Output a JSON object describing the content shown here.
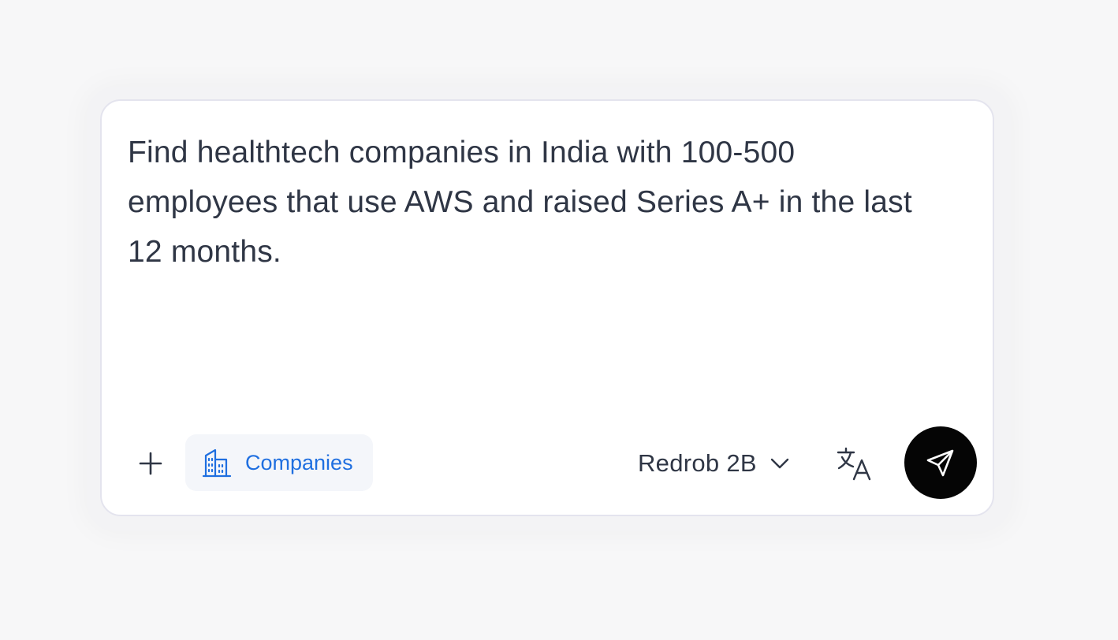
{
  "prompt": {
    "text": "Find healthtech companies in India with 100-500 employees that use AWS and raised Series A+ in the last 12 months."
  },
  "toolbar": {
    "add_icon": "plus-icon",
    "chip": {
      "icon": "building-icon",
      "label": "Companies",
      "color": "#1f6fe0"
    },
    "model": {
      "label": "Redrob 2B",
      "icon": "chevron-down-icon"
    },
    "translate_icon": "translate-icon",
    "send": {
      "icon": "send-icon",
      "background": "#050505"
    }
  }
}
